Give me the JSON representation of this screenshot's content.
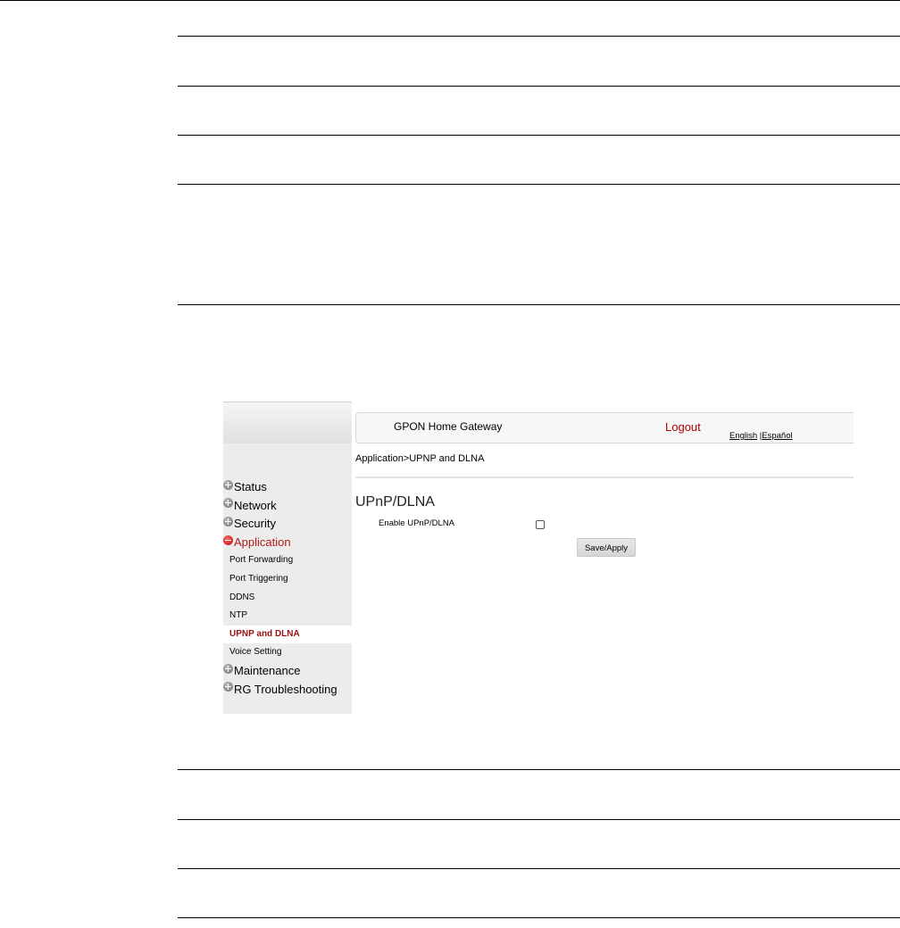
{
  "router_ui": {
    "header": {
      "title": "GPON Home Gateway",
      "logout_label": "Logout",
      "lang_english": "English",
      "lang_separator": " |",
      "lang_spanish": "Español"
    },
    "breadcrumb": "Application>UPNP and DLNA",
    "sidebar": {
      "items": [
        {
          "label": "Status",
          "icon": "plus-circle-icon"
        },
        {
          "label": "Network",
          "icon": "plus-circle-icon"
        },
        {
          "label": "Security",
          "icon": "plus-circle-icon"
        },
        {
          "label": "Application",
          "icon": "minus-circle-icon",
          "expanded": true,
          "subitems": [
            {
              "label": "Port Forwarding"
            },
            {
              "label": "Port Triggering"
            },
            {
              "label": "DDNS"
            },
            {
              "label": "NTP"
            },
            {
              "label": "UPNP and DLNA",
              "selected": true
            },
            {
              "label": "Voice Setting"
            }
          ]
        },
        {
          "label": "Maintenance",
          "icon": "plus-circle-icon"
        },
        {
          "label": "RG Troubleshooting",
          "icon": "plus-circle-icon"
        }
      ]
    },
    "content": {
      "section_title": "UPnP/DLNA",
      "enable_label": "Enable UPnP/DLNA",
      "enable_checked": false,
      "save_label": "Save/Apply"
    },
    "colors": {
      "accent_red": "#b00000",
      "selected_item_red": "#9b1010",
      "sidebar_bg": "#ececec"
    }
  }
}
